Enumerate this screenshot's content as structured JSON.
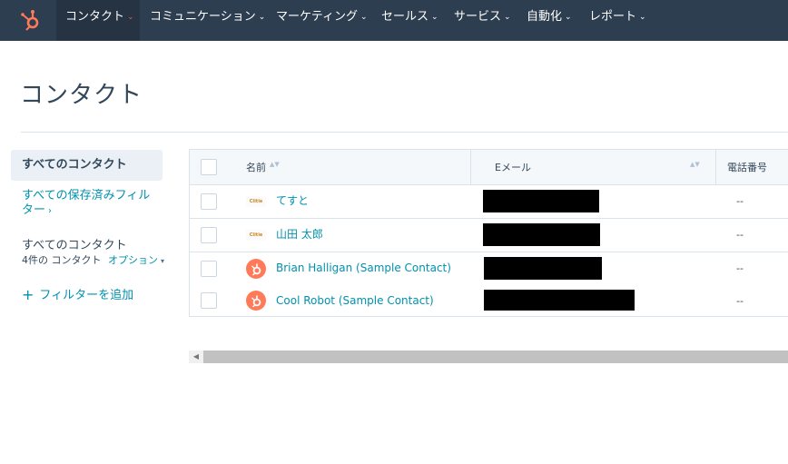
{
  "nav": {
    "items": [
      {
        "label": "コンタクト"
      },
      {
        "label": "コミュニケーション"
      },
      {
        "label": "マーケティング"
      },
      {
        "label": "セールス"
      },
      {
        "label": "サービス"
      },
      {
        "label": "自動化"
      },
      {
        "label": "レポート"
      }
    ],
    "caret": "⌄"
  },
  "page": {
    "title": "コンタクト"
  },
  "sidebar": {
    "active_view": "すべてのコンタクト",
    "saved_filters_link": "すべての保存済みフィルター",
    "saved_filters_chevron": "›",
    "view_title": "すべてのコンタクト",
    "view_count": "4件の コンタクト",
    "options_link": "オプション",
    "options_caret": "▾",
    "add_filter_plus": "+",
    "add_filter_label": "フィルターを追加"
  },
  "table": {
    "columns": {
      "name": "名前",
      "email": "Eメール",
      "phone": "電話番号"
    },
    "sort_glyph": "▲▼",
    "rows": [
      {
        "name": "てすと",
        "phone": "--",
        "avatar": "photo",
        "avatar_text": "Clitie"
      },
      {
        "name": "山田 太郎",
        "phone": "--",
        "avatar": "photo",
        "avatar_text": "Clitie"
      },
      {
        "name": "Brian Halligan (Sample Contact)",
        "phone": "--",
        "avatar": "hubspot"
      },
      {
        "name": "Cool Robot (Sample Contact)",
        "phone": "--",
        "avatar": "hubspot"
      }
    ]
  },
  "scrollbar": {
    "left_arrow": "◀"
  },
  "colors": {
    "nav_bg": "#2d3e50",
    "accent_orange": "#ff7a59",
    "link_teal": "#0091ae",
    "text_dark": "#33475b"
  }
}
